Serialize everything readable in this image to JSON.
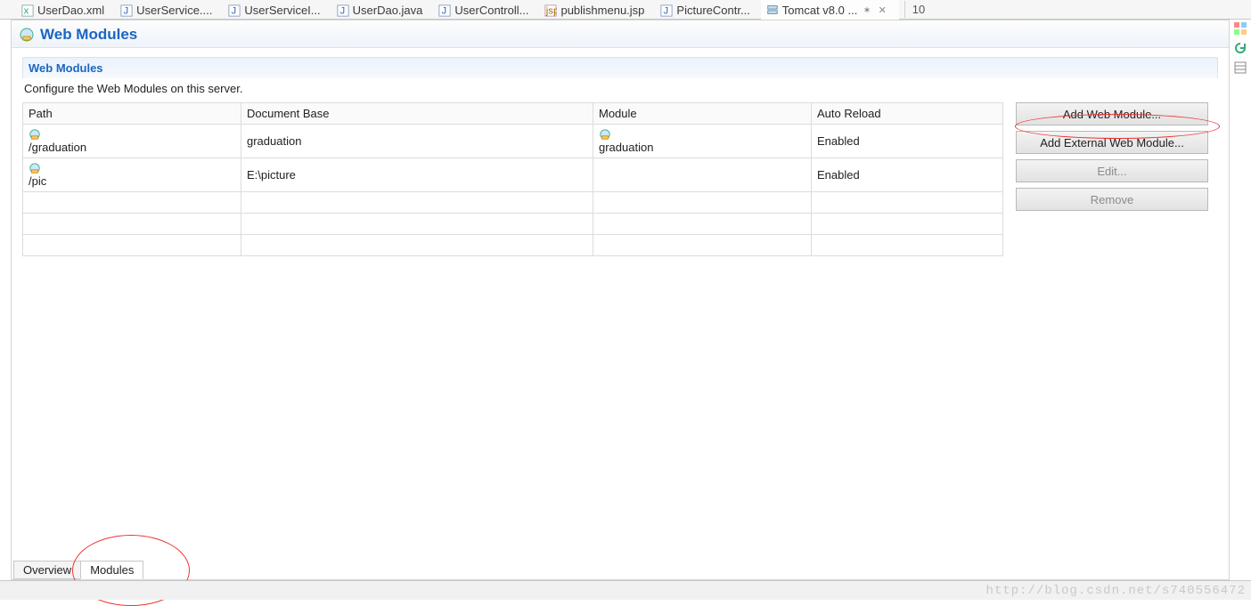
{
  "tabs": [
    {
      "label": "UserDao.xml",
      "icon": "xml"
    },
    {
      "label": "UserService....",
      "icon": "java"
    },
    {
      "label": "UserServiceI...",
      "icon": "java"
    },
    {
      "label": "UserDao.java",
      "icon": "java"
    },
    {
      "label": "UserControll...",
      "icon": "java"
    },
    {
      "label": "publishmenu.jsp",
      "icon": "jsp"
    },
    {
      "label": "PictureContr...",
      "icon": "java"
    },
    {
      "label": "Tomcat v8.0 ...",
      "icon": "server",
      "active": true,
      "closable": true
    }
  ],
  "pageIndicator": "10",
  "section": {
    "title": "Web Modules",
    "panelTitle": "Web Modules",
    "description": "Configure the Web Modules on this server."
  },
  "columns": [
    "Path",
    "Document Base",
    "Module",
    "Auto Reload"
  ],
  "rows": [
    {
      "path": "/graduation",
      "docbase": "graduation",
      "module": "graduation",
      "autoreload": "Enabled"
    },
    {
      "path": "/pic",
      "docbase": "E:\\picture",
      "module": "",
      "autoreload": "Enabled"
    },
    {
      "path": "",
      "docbase": "",
      "module": "",
      "autoreload": ""
    },
    {
      "path": "",
      "docbase": "",
      "module": "",
      "autoreload": ""
    },
    {
      "path": "",
      "docbase": "",
      "module": "",
      "autoreload": ""
    }
  ],
  "buttons": {
    "add": "Add Web Module...",
    "addExternal": "Add External Web Module...",
    "edit": "Edit...",
    "remove": "Remove"
  },
  "subTabs": {
    "overview": "Overview",
    "modules": "Modules"
  },
  "watermark": "http://blog.csdn.net/s740556472"
}
